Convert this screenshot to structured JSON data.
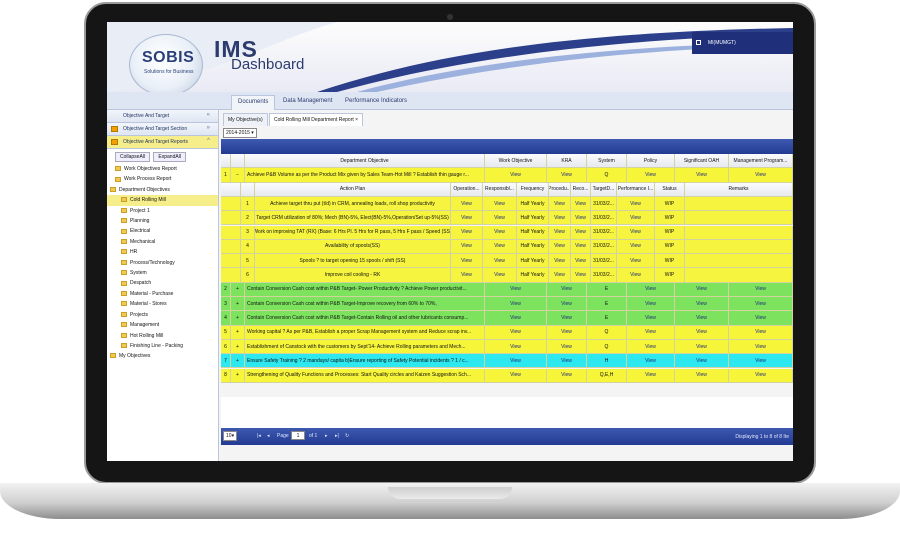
{
  "app": {
    "logo": "SOBIS",
    "logo_sub": "Solutions for Business",
    "title": "IMS",
    "subtitle": "Dashboard",
    "user": "MI(MUMGT)"
  },
  "nav_tabs": [
    "Documents",
    "Data Management",
    "Performance Indicators"
  ],
  "left": {
    "headers": [
      "Objective And Target",
      "Objective And Target Section",
      "Objective And Target Reports"
    ],
    "buttons": [
      "CollapseAll",
      "ExpandAll"
    ],
    "tree": [
      "Work Objectives Report",
      "Work Process Report",
      "Department Objectives",
      "Cold Rolling Mill",
      "Project 1",
      "Planning",
      "Electrical",
      "Mechanical",
      "HR",
      "Process/Technology",
      "System",
      "Despatch",
      "Material - Purchase",
      "Material - Stores",
      "Projects",
      "Management",
      "Hot Rolling Mill",
      "Finishing Line - Packing",
      "My Objectives"
    ]
  },
  "content_tabs": [
    "My Objective(s)",
    "Cold Rolling Mill Department Report"
  ],
  "year": "2014-2015",
  "main_headers": [
    "Department Objective",
    "Work Objective",
    "KRA",
    "System",
    "Policy",
    "Significant OAH",
    "Management Program..."
  ],
  "sub_headers": [
    "Action Plan",
    "Operation...",
    "Responsibl...",
    "Frequency",
    "Procedu...",
    "Reco...",
    "TargetD...",
    "Performance I...",
    "Status",
    "Remarks"
  ],
  "rows": [
    {
      "n": "1",
      "sign": "−",
      "text": "Achieve P&B Volume as per the Product Mix given by Sales Team-Hot Mill ? Establish thin gauge r...",
      "wo": "View",
      "kra": "View",
      "sys": "Q",
      "pol": "View",
      "oah": "View",
      "mp": "View",
      "color": "yel"
    },
    {
      "n": "2",
      "sign": "+",
      "text": "Contain Conversion Cash cost within P&B Target- Power Productivity ? Achieve Power productivit...",
      "wo": "View",
      "kra": "View",
      "sys": "E",
      "pol": "View",
      "oah": "View",
      "mp": "View",
      "color": "grn"
    },
    {
      "n": "3",
      "sign": "+",
      "text": "Contain Conversion Cash cost within P&B Target-Improve recovery from 60% to 70%,",
      "wo": "View",
      "kra": "View",
      "sys": "E",
      "pol": "View",
      "oah": "View",
      "mp": "View",
      "color": "grn"
    },
    {
      "n": "4",
      "sign": "+",
      "text": "Contain Conversion Cash cost within P&B Target-Contain Rolling oil and other lubricants consump...",
      "wo": "View",
      "kra": "View",
      "sys": "E",
      "pol": "View",
      "oah": "View",
      "mp": "View",
      "color": "grn"
    },
    {
      "n": "5",
      "sign": "+",
      "text": "Working capital ? As per P&B, Establish a proper Scrap Management system and Reduce scrap inv...",
      "wo": "View",
      "kra": "View",
      "sys": "Q",
      "pol": "View",
      "oah": "View",
      "mp": "View",
      "color": "yel"
    },
    {
      "n": "6",
      "sign": "+",
      "text": "Establishment of Canstock with the customers by Sept'14- Achieve Rolling parameters and Mech...",
      "wo": "View",
      "kra": "View",
      "sys": "Q",
      "pol": "View",
      "oah": "View",
      "mp": "View",
      "color": "yel"
    },
    {
      "n": "7",
      "sign": "+",
      "text": "Ensure Safety Training ? 2 mandays/ capita b)Ensure reporting of Safety Potential incidents ? 1 / c...",
      "wo": "View",
      "kra": "View",
      "sys": "H",
      "pol": "View",
      "oah": "View",
      "mp": "View",
      "color": "cyn"
    },
    {
      "n": "8",
      "sign": "+",
      "text": "Strengthening of Quality Functions and Processes: Start Quality circles and Kaizen Suggestion Sch...",
      "wo": "View",
      "kra": "View",
      "sys": "Q,E,H",
      "pol": "View",
      "oah": "View",
      "mp": "View",
      "color": "yel"
    }
  ],
  "sub_rows": [
    {
      "n": "1",
      "plan": "Achieve target thru put (t/d) in CRM, annealing loads, roll shop productivity",
      "op": "View",
      "resp": "View",
      "freq": "Half Yearly",
      "proc": "View",
      "reco": "View",
      "target": "31/03/2...",
      "perf": "View",
      "status": "WIP",
      "remarks": ""
    },
    {
      "n": "2",
      "plan": "Target CRM utilization of 80%; Mech (BN)-5%, Elect(BN)-5%,Operation/Set up-5%(SS)",
      "op": "View",
      "resp": "View",
      "freq": "Half Yearly",
      "proc": "View",
      "reco": "View",
      "target": "31/03/2...",
      "perf": "View",
      "status": "WIP",
      "remarks": ""
    },
    {
      "n": "3",
      "plan": "Work on improving TAT (RX) (Base: 6 Hrs Pl. 5 Hrs for R pass, 5 Hrs F pass / Speed (SS)",
      "op": "View",
      "resp": "View",
      "freq": "Half Yearly",
      "proc": "View",
      "reco": "View",
      "target": "31/03/2...",
      "perf": "View",
      "status": "WIP",
      "remarks": ""
    },
    {
      "n": "4",
      "plan": "Availability of spools(SS)",
      "op": "View",
      "resp": "View",
      "freq": "Half Yearly",
      "proc": "View",
      "reco": "View",
      "target": "31/03/2...",
      "perf": "View",
      "status": "WIP",
      "remarks": ""
    },
    {
      "n": "5",
      "plan": "Spools ? to target opening 15 spools / shift (SS)",
      "op": "View",
      "resp": "View",
      "freq": "Half Yearly",
      "proc": "View",
      "reco": "View",
      "target": "31/03/2...",
      "perf": "View",
      "status": "WIP",
      "remarks": ""
    },
    {
      "n": "6",
      "plan": "Improve coil cooling - RK",
      "op": "View",
      "resp": "View",
      "freq": "Half Yearly",
      "proc": "View",
      "reco": "View",
      "target": "31/03/2...",
      "perf": "View",
      "status": "WIP",
      "remarks": ""
    }
  ],
  "pager": {
    "size": "10",
    "page_label": "Page",
    "page": "1",
    "of": "of 1",
    "display": "Displaying 1 to 8 of 8 Ite"
  }
}
